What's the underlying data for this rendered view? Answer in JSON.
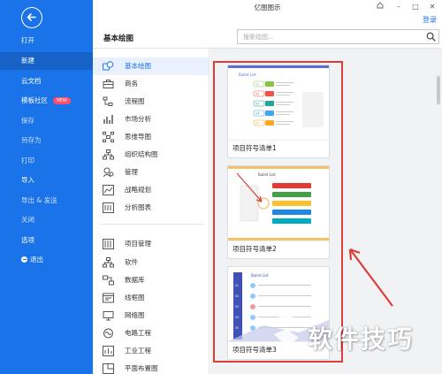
{
  "app": {
    "title": "亿图图示",
    "login": "登录"
  },
  "window": {
    "minimize": "–",
    "maximize": "□",
    "close": "✕",
    "pin": "⌂"
  },
  "sidebar": {
    "back_icon": "arrow-left-icon",
    "items": [
      {
        "label": "打开"
      },
      {
        "label": "新建"
      },
      {
        "label": "云文档"
      },
      {
        "label": "模板社区",
        "badge": "NEW"
      },
      {
        "label": "保存"
      },
      {
        "label": "另存为"
      },
      {
        "label": "打印"
      },
      {
        "label": "导入"
      },
      {
        "label": "导出 & 发送"
      },
      {
        "label": "关闭"
      },
      {
        "label": "选项"
      },
      {
        "label": "退出"
      }
    ]
  },
  "header": {
    "title": "基本绘图",
    "search_placeholder": "搜索绘图..."
  },
  "categories": [
    {
      "label": "基本绘图",
      "icon": "shapes-icon"
    },
    {
      "label": "商务",
      "icon": "briefcase-icon"
    },
    {
      "label": "流程图",
      "icon": "flowchart-icon"
    },
    {
      "label": "市场分析",
      "icon": "bar-chart-icon"
    },
    {
      "label": "思维导图",
      "icon": "mindmap-icon"
    },
    {
      "label": "组织结构图",
      "icon": "org-chart-icon"
    },
    {
      "label": "管理",
      "icon": "management-icon"
    },
    {
      "label": "战略规划",
      "icon": "strategy-icon"
    },
    {
      "label": "分析图表",
      "icon": "analysis-chart-icon"
    },
    {
      "label": "项目管理",
      "icon": "project-icon"
    },
    {
      "label": "软件",
      "icon": "software-icon"
    },
    {
      "label": "数据库",
      "icon": "database-icon"
    },
    {
      "label": "线框图",
      "icon": "wireframe-icon"
    },
    {
      "label": "网络图",
      "icon": "network-icon"
    },
    {
      "label": "电路工程",
      "icon": "circuit-icon"
    },
    {
      "label": "工业工程",
      "icon": "industry-icon"
    },
    {
      "label": "平面布置图",
      "icon": "floorplan-icon"
    }
  ],
  "templates": [
    {
      "label": "项目符号清单1",
      "thumb_title": "Bullet List",
      "steps": [
        "01",
        "02",
        "03",
        "04",
        "05"
      ],
      "colors": [
        "#8bc34a",
        "#ef5350",
        "#26a69a",
        "#42a5f5",
        "#ffa726"
      ]
    },
    {
      "label": "项目符号清单2",
      "thumb_title": "Bullet List",
      "colors": [
        "#e53935",
        "#43a047",
        "#fbc02d",
        "#1e88e5",
        "#00acc1"
      ]
    },
    {
      "label": "项目符号清单3",
      "thumb_title": "Bullet List",
      "steps": [
        "01",
        "02",
        "03",
        "04",
        "05"
      ]
    }
  ],
  "watermark": {
    "text": "软件技巧"
  },
  "colors": {
    "sidebar": "#1a73e8",
    "accent": "#1a73e8",
    "highlight": "#e03c3c"
  }
}
